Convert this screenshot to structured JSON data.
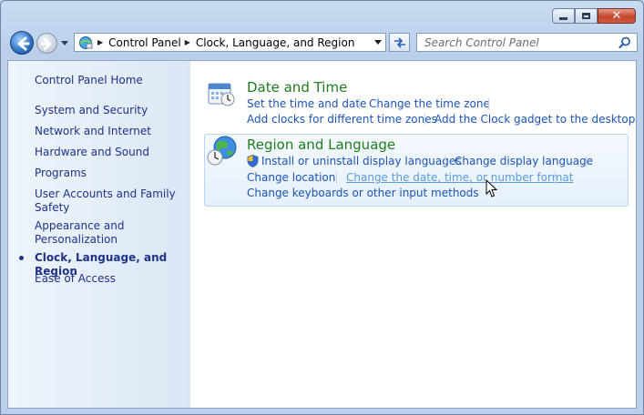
{
  "window": {
    "caption_buttons": [
      "minimize",
      "maximize",
      "close"
    ]
  },
  "address_bar": {
    "breadcrumb": [
      "Control Panel",
      "Clock, Language, and Region"
    ]
  },
  "search": {
    "placeholder": "Search Control Panel"
  },
  "sidebar": {
    "items": [
      {
        "label": "Control Panel Home",
        "current": false
      },
      {
        "label": "System and Security",
        "current": false
      },
      {
        "label": "Network and Internet",
        "current": false
      },
      {
        "label": "Hardware and Sound",
        "current": false
      },
      {
        "label": "Programs",
        "current": false
      },
      {
        "label": "User Accounts and Family Safety",
        "current": false
      },
      {
        "label": "Appearance and Personalization",
        "current": false
      },
      {
        "label": "Clock, Language, and Region",
        "current": true
      },
      {
        "label": "Ease of Access",
        "current": false
      }
    ]
  },
  "categories": [
    {
      "title": "Date and Time",
      "icon": "calendar-clock-icon",
      "tasks": [
        "Set the time and date",
        "Change the time zone",
        "Add clocks for different time zones",
        "Add the Clock gadget to the desktop"
      ]
    },
    {
      "title": "Region and Language",
      "icon": "globe-clock-icon",
      "tasks": [
        "Install or uninstall display languages",
        "Change display language",
        "Change location",
        "Change the date, time, or number format",
        "Change keyboards or other input methods"
      ]
    }
  ],
  "colors": {
    "link": "#1c53b4",
    "category_title": "#1e7d1e",
    "hover_link": "#5b9bd8"
  }
}
